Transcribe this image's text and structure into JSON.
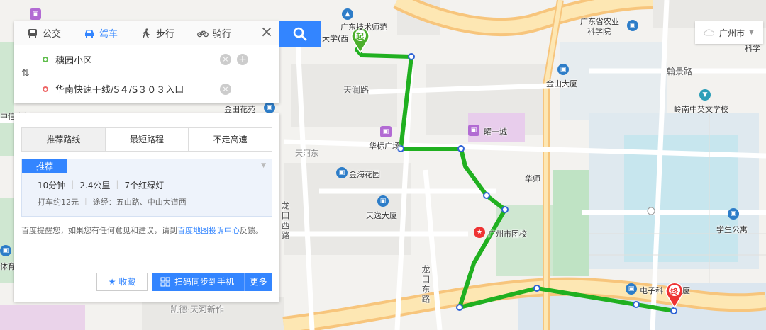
{
  "modes": [
    {
      "label": "公交",
      "icon": "bus-icon",
      "active": false
    },
    {
      "label": "驾车",
      "icon": "car-icon",
      "active": true
    },
    {
      "label": "步行",
      "icon": "walk-icon",
      "active": false
    },
    {
      "label": "骑行",
      "icon": "bike-icon",
      "active": false
    }
  ],
  "close_label": "×",
  "start_point": "穗园小区",
  "end_point": "华南快速干线/S４/S３０３入口",
  "tabs": [
    "推荐路线",
    "最短路程",
    "不走高速"
  ],
  "route": {
    "tag": "推荐",
    "time": "10分钟",
    "distance": "2.4公里",
    "lights": "7个红绿灯",
    "taxi": "打车约12元",
    "via": "途经：五山路、中山大道西"
  },
  "tip": {
    "prefix": "百度提醒您，如果您有任何意见和建议，请到",
    "link": "百度地图投诉中心",
    "suffix": "反馈。"
  },
  "actions": {
    "favorite": "收藏",
    "sync": "扫码同步到手机",
    "more": "更多"
  },
  "city": "广州市",
  "markers": {
    "start": "起",
    "end": "终"
  },
  "colors": {
    "accent": "#3385ff",
    "route": "#20b020"
  },
  "map_labels": {
    "school_1": "广东技术师范",
    "school_2": "大学(西",
    "agri_1": "广东省农业",
    "agri_2": "科学院",
    "tech_edge": "科学",
    "hanjing": "翰景路",
    "tianrun": "天润路",
    "jinshan": "金山大厦",
    "lingnan": "岭南中英文学校",
    "jindian": "金田花苑",
    "zhongxin": "中信广场",
    "huabiao": "华标广场",
    "yaoyi": "曜一城",
    "tianhedong": "天河东",
    "jinhai": "金海花园",
    "huashi": "华师",
    "tianyi": "天逸大厦",
    "longkouxi": "龙口西路",
    "tuanxiao": "广州市团校",
    "student": "学生公寓",
    "yuzhong": "体育中",
    "longkoudong": "龙口东路",
    "dianzi": "电子科",
    "dianzi_end": "厦",
    "kaide": "凯德·天河新作"
  }
}
